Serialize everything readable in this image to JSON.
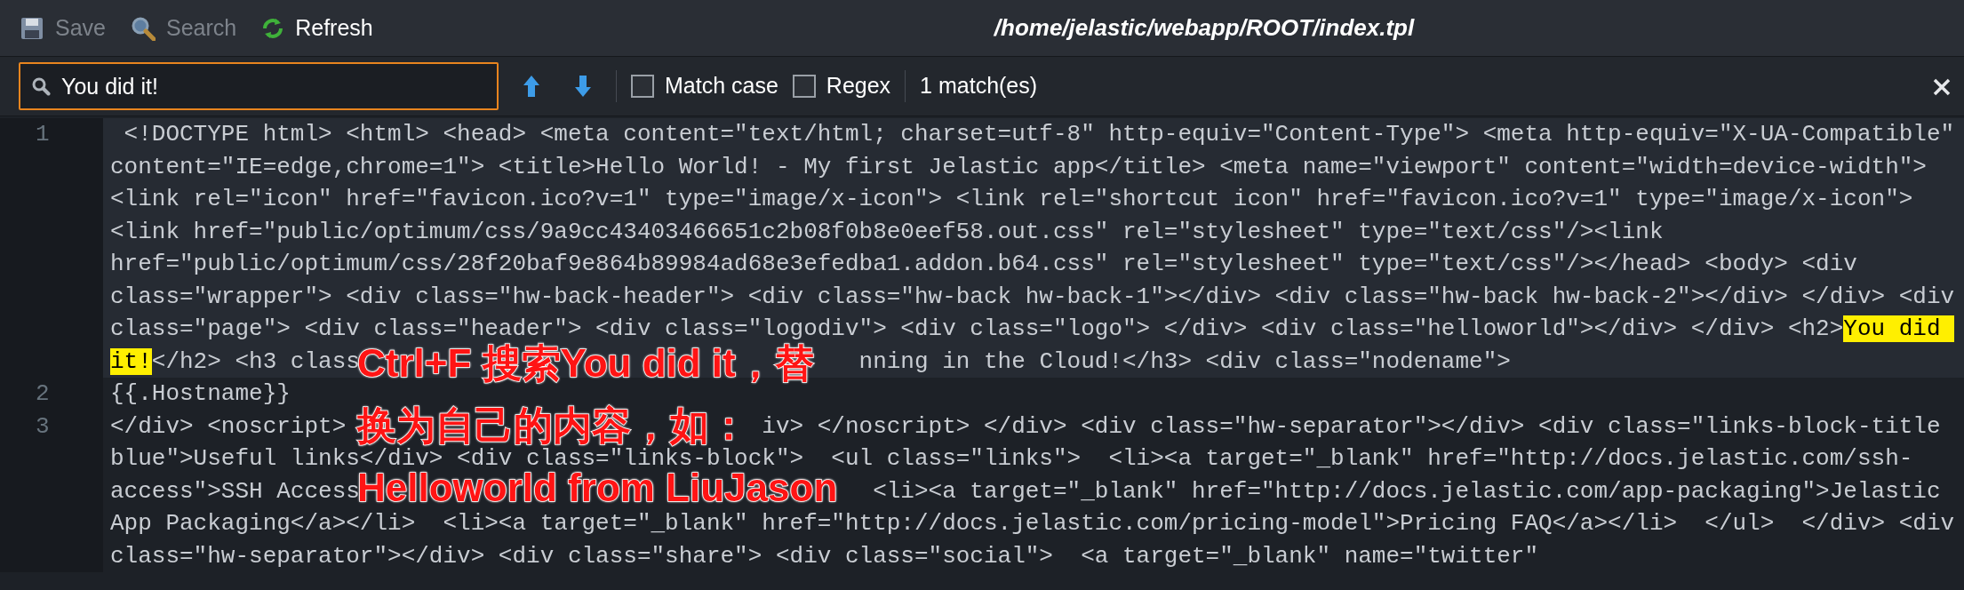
{
  "toolbar": {
    "buttons": [
      {
        "kind": "save",
        "label": "Save",
        "disabled": true
      },
      {
        "kind": "search",
        "label": "Search",
        "disabled": true
      },
      {
        "kind": "refresh",
        "label": "Refresh",
        "disabled": false
      }
    ],
    "file_path": "/home/jelastic/webapp/ROOT/index.tpl"
  },
  "find_bar": {
    "value": "You did it!",
    "options": [
      {
        "label": "Match case",
        "checked": false
      },
      {
        "label": "Regex",
        "checked": false
      }
    ],
    "result": "1 match(es)"
  },
  "editor": {
    "lines": [
      {
        "number": "1",
        "current": true,
        "rows": [
          {
            "spans": [
              {
                "text": " <!DOCTYPE html> <html> <head> <meta content=\"text/html; charset=utf-8\" http-equiv=\"Content-Type\"> <meta http-equiv=\"X-UA-Compatible\"",
                "match": false
              }
            ]
          },
          {
            "spans": [
              {
                "text": "content=\"IE=edge,chrome=1\"> <title>Hello World! - My first Jelastic app</title> <meta name=\"viewport\" content=\"width=device-width\">",
                "match": false
              }
            ]
          },
          {
            "spans": [
              {
                "text": "<link rel=\"icon\" href=\"favicon.ico?v=1\" type=\"image/x-icon\"> <link rel=\"shortcut icon\" href=\"favicon.ico?v=1\" type=\"image/x-icon\">",
                "match": false
              }
            ]
          },
          {
            "spans": [
              {
                "text": "<link href=\"public/optimum/css/9a9cc43403466651c2b08f0b8e0eef58.out.css\" rel=\"stylesheet\" type=\"text/css\"/><link",
                "match": false
              }
            ]
          },
          {
            "spans": [
              {
                "text": "href=\"public/optimum/css/28f20baf9e864b89984ad68e3efedba1.addon.b64.css\" rel=\"stylesheet\" type=\"text/css\"/></head> <body> <div",
                "match": false
              }
            ]
          },
          {
            "spans": [
              {
                "text": "class=\"wrapper\"> <div class=\"hw-back-header\"> <div class=\"hw-back hw-back-1\"></div> <div class=\"hw-back hw-back-2\"></div> </div> <div",
                "match": false
              }
            ]
          },
          {
            "spans": [
              {
                "text": "class=\"page\"> <div class=\"header\"> <div class=\"logodiv\"> <div class=\"logo\"> </div> <div class=\"helloworld\"></div> </div> <h2>",
                "match": false
              },
              {
                "text": "You did ",
                "match": true
              }
            ]
          },
          {
            "spans": [
              {
                "text": "it!",
                "match": true
              },
              {
                "text": "</h2> <h3 class",
                "match": false
              },
              {
                "text": "nning in the Cloud!</h3> <div class=\"nodename\">",
                "match": false
              }
            ]
          }
        ]
      },
      {
        "number": "2",
        "current": false,
        "rows": [
          {
            "spans": [
              {
                "text": "{{.Hostname}}",
                "match": false
              }
            ]
          }
        ]
      },
      {
        "number": "3",
        "current": false,
        "rows": [
          {
            "spans": [
              {
                "text": "</div> <noscript>",
                "match": false
              },
              {
                "text": "iv> </noscript> </div> <div class=\"hw-separator\"></div> <div class=\"links-block-title",
                "match": false
              }
            ]
          },
          {
            "spans": [
              {
                "text": "blue\">Useful links</div> <div class=\"links-block\">  <ul class=\"links\">  <li><a target=\"_blank\" href=\"http://docs.jelastic.com/ssh-",
                "match": false
              }
            ]
          },
          {
            "spans": [
              {
                "text": "access\">SSH Access",
                "match": false
              },
              {
                "text": "<li><a target=\"_blank\" href=\"http://docs.jelastic.com/app-packaging\">Jelastic",
                "match": false
              }
            ]
          },
          {
            "spans": [
              {
                "text": "App Packaging</a></li>  <li><a target=\"_blank\" href=\"http://docs.jelastic.com/pricing-model\">Pricing FAQ</a></li>  </ul>  </div> <div",
                "match": false
              }
            ]
          },
          {
            "spans": [
              {
                "text": "class=\"hw-separator\"></div> <div class=\"share\"> <div class=\"social\">  <a target=\"_blank\" name=\"twitter\"",
                "match": false
              }
            ]
          }
        ]
      }
    ]
  },
  "annotation": {
    "lines": [
      "Ctrl+F 搜索You did it，替",
      "换为自己的内容，如：",
      "Helloworld from LiuJason"
    ]
  }
}
